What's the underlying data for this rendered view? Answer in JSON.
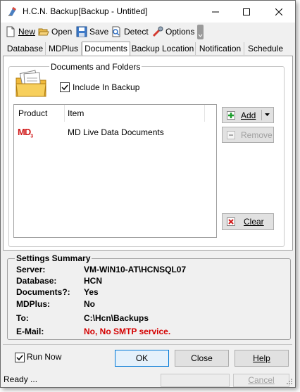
{
  "window": {
    "title": "H.C.N. Backup[Backup - Untitled]"
  },
  "toolbar": {
    "new_label": "New",
    "open_label": "Open",
    "save_label": "Save",
    "detect_label": "Detect",
    "options_label": "Options"
  },
  "tabs": [
    {
      "label": "Database"
    },
    {
      "label": "MDPlus"
    },
    {
      "label": "Documents"
    },
    {
      "label": "Backup Location"
    },
    {
      "label": "Notification"
    },
    {
      "label": "Schedule"
    }
  ],
  "documents": {
    "group_title": "Documents and Folders",
    "include_label": "Include In Backup",
    "include_checked": true,
    "columns": {
      "product": "Product",
      "item": "Item"
    },
    "rows": [
      {
        "product_icon": "MD",
        "product_icon_sub": "3",
        "item": "MD Live Data Documents"
      }
    ],
    "add_label": "Add",
    "remove_label": "Remove",
    "clear_label": "Clear"
  },
  "summary": {
    "title": "Settings Summary",
    "rows": [
      {
        "label": "Server:",
        "value": "VM-WIN10-AT\\HCNSQL07"
      },
      {
        "label": "Database:",
        "value": "HCN"
      },
      {
        "label": "Documents?:",
        "value": "Yes"
      },
      {
        "label": "MDPlus:",
        "value": "No"
      },
      {
        "label": "To:",
        "value": "C:\\Hcn\\Backups"
      },
      {
        "label": "E-Mail:",
        "value": "No, No SMTP service."
      }
    ],
    "error_color": "#d40000"
  },
  "bottom": {
    "run_now_label": "Run Now",
    "run_now_checked": true,
    "ok_label": "OK",
    "close_label": "Close",
    "help_label": "Help"
  },
  "status": {
    "text": "Ready ...",
    "cancel_label": "Cancel"
  }
}
